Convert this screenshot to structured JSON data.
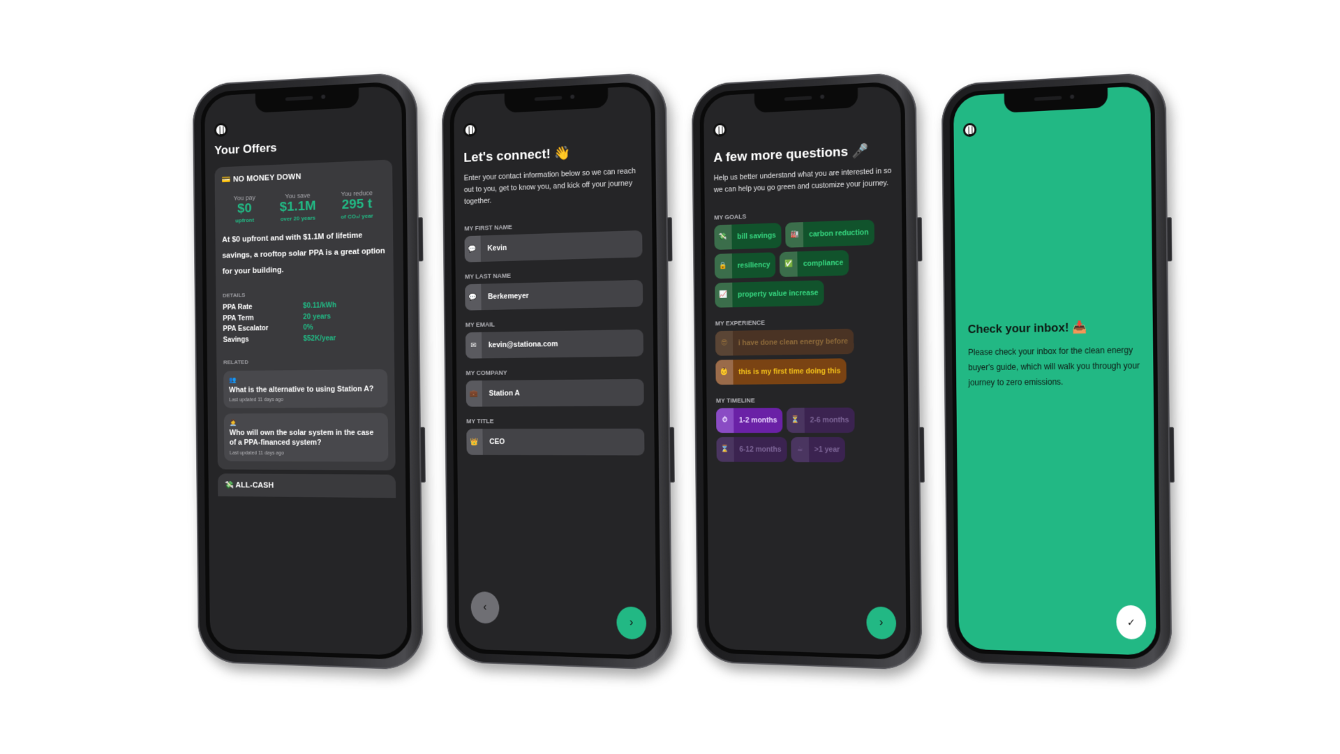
{
  "phones": {
    "offers": {
      "title": "Your Offers",
      "offer": {
        "emoji": "💳",
        "heading": "NO MONEY DOWN",
        "stats": [
          {
            "label": "You pay",
            "value": "$0",
            "sub": "upfront"
          },
          {
            "label": "You save",
            "value": "$1.1M",
            "sub": "over 20 years"
          },
          {
            "label": "You reduce",
            "value": "295 t",
            "sub": "of CO₂/ year"
          }
        ],
        "description": "At $0 upfront and with $1.1M of lifetime savings, a rooftop solar PPA is a great option for your building.",
        "details_label": "DETAILS",
        "details": [
          {
            "key": "PPA Rate",
            "value": "$0.11/kWh"
          },
          {
            "key": "PPA Term",
            "value": "20 years"
          },
          {
            "key": "PPA Escalator",
            "value": "0%"
          },
          {
            "key": "Savings",
            "value": "$52K/year"
          }
        ],
        "related_label": "RELATED",
        "related": [
          {
            "emoji": "👥",
            "question": "What is the alternative to using Station A?",
            "updated": "Last updated 11 days ago"
          },
          {
            "emoji": "🧑‍💼",
            "question": "Who will own the solar system in the case of a PPA-financed system?",
            "updated": "Last updated 11 days ago"
          }
        ]
      },
      "next_offer": {
        "emoji": "💸",
        "heading": "ALL-CASH"
      }
    },
    "connect": {
      "title": "Let's connect! 👋",
      "description": "Enter your contact information below so we can reach out to you, get to know you, and kick off your journey together.",
      "fields": [
        {
          "label": "MY FIRST NAME",
          "icon": "💬",
          "value": "Kevin"
        },
        {
          "label": "MY LAST NAME",
          "icon": "💬",
          "value": "Berkemeyer"
        },
        {
          "label": "MY EMAIL",
          "icon": "✉",
          "value": "kevin@stationa.com"
        },
        {
          "label": "MY COMPANY",
          "icon": "💼",
          "value": "Station A"
        },
        {
          "label": "MY TITLE",
          "icon": "👑",
          "value": "CEO"
        }
      ],
      "back_icon": "‹",
      "next_icon": "›"
    },
    "questions": {
      "title": "A few more questions 🎤",
      "description": "Help us better understand what you are interested in so we can help you go green and customize your journey.",
      "goals_label": "MY GOALS",
      "goals": [
        {
          "icon": "💸",
          "label": "bill savings"
        },
        {
          "icon": "🏭",
          "label": "carbon reduction"
        },
        {
          "icon": "🔒",
          "label": "resiliency"
        },
        {
          "icon": "✅",
          "label": "compliance"
        },
        {
          "icon": "📈",
          "label": "property value increase"
        }
      ],
      "experience_label": "MY EXPERIENCE",
      "experience": [
        {
          "icon": "😎",
          "label": "i have done clean energy before",
          "selected": false
        },
        {
          "icon": "👶",
          "label": "this is my first time doing this",
          "selected": true
        }
      ],
      "timeline_label": "MY TIMELINE",
      "timeline": [
        {
          "icon": "⏱",
          "label": "1-2 months",
          "selected": true
        },
        {
          "icon": "⏳",
          "label": "2-6 months",
          "selected": false
        },
        {
          "icon": "⌛",
          "label": "6-12 months",
          "selected": false
        },
        {
          "icon": "☕",
          "label": ">1 year",
          "selected": false
        }
      ],
      "next_icon": "›"
    },
    "inbox": {
      "title": "Check your inbox! 📥",
      "description": "Please check your inbox for the clean energy buyer's guide, which will walk you through your journey to zero emissions.",
      "done_icon": "✓"
    }
  },
  "colors": {
    "accent": "#22b884",
    "screen_bg": "#252527",
    "card_bg": "#3a3a3d"
  }
}
